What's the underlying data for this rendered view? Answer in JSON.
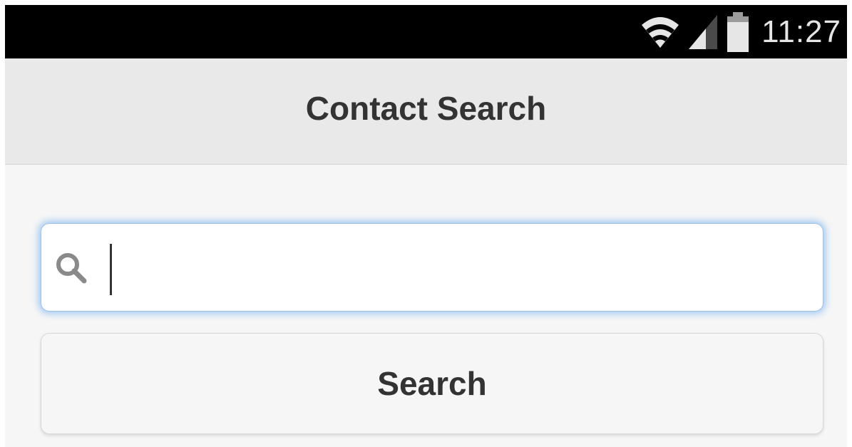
{
  "status_bar": {
    "time": "11:27",
    "icons": [
      "wifi-icon",
      "cell-signal-icon",
      "battery-icon"
    ]
  },
  "header": {
    "title": "Contact Search"
  },
  "search": {
    "placeholder": "",
    "value": "",
    "icon": "search-icon"
  },
  "actions": {
    "search_button_label": "Search"
  },
  "colors": {
    "status_bar_bg": "#000000",
    "header_bg": "#e9e9e9",
    "content_bg": "#f6f6f6",
    "focus_glow": "#388ef0",
    "text": "#333333"
  }
}
